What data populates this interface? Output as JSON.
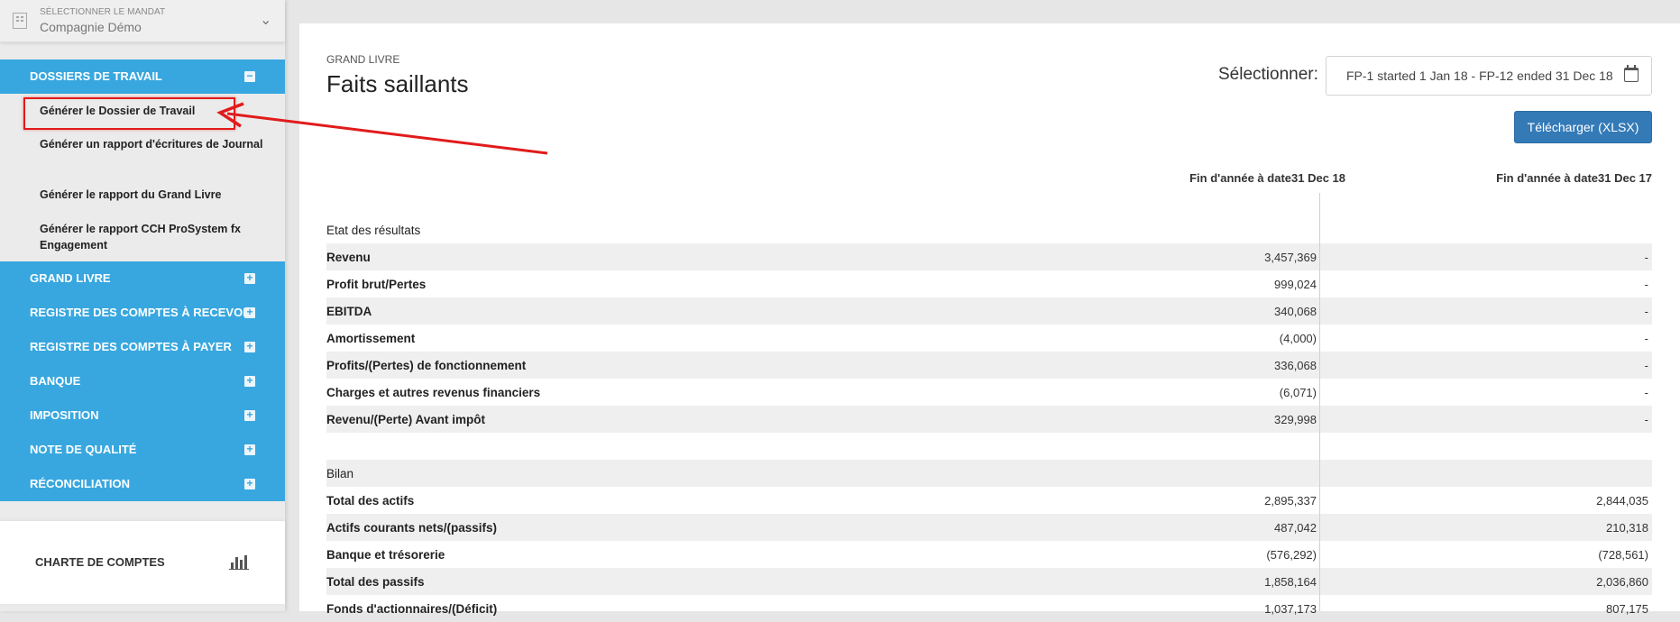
{
  "mandate": {
    "caption": "SÉLECTIONNER LE MANDAT",
    "name": "Compagnie Démo"
  },
  "sidebar": {
    "sections": [
      {
        "label": "DOSSIERS DE TRAVAIL",
        "toggle": "−"
      },
      {
        "label": "GRAND LIVRE",
        "toggle": "+"
      },
      {
        "label": "REGISTRE DES COMPTES À RECEVOIR",
        "toggle": "+"
      },
      {
        "label": "REGISTRE DES COMPTES À PAYER",
        "toggle": "+"
      },
      {
        "label": "BANQUE",
        "toggle": "+"
      },
      {
        "label": "IMPOSITION",
        "toggle": "+"
      },
      {
        "label": "NOTE DE QUALITÉ",
        "toggle": "+"
      },
      {
        "label": "RÉCONCILIATION",
        "toggle": "+"
      }
    ],
    "sub_items": [
      "Générer le Dossier de Travail",
      "Générer un rapport d'écritures de Journal",
      "Générer le rapport du Grand Livre",
      "Générer le rapport CCH ProSystem fx Engagement"
    ],
    "bottom_label": "CHARTE DE COMPTES"
  },
  "main": {
    "breadcrumb": "GRAND LIVRE",
    "title": "Faits saillants",
    "select_label": "Sélectionner:",
    "period": "FP-1 started 1 Jan 18 - FP-12 ended 31 Dec 18",
    "download_label": "Télécharger (XLSX)",
    "col1_header": "Fin d'année à date31 Dec 18",
    "col2_header": "Fin d'année à date31 Dec 17",
    "rows": [
      {
        "label": "Etat des résultats",
        "v1": "",
        "v2": "",
        "heading": true
      },
      {
        "label": "Revenu",
        "v1": "3,457,369",
        "v2": "-"
      },
      {
        "label": "Profit brut/Pertes",
        "v1": "999,024",
        "v2": "-"
      },
      {
        "label": "EBITDA",
        "v1": "340,068",
        "v2": "-"
      },
      {
        "label": "Amortissement",
        "v1": "(4,000)",
        "v2": "-"
      },
      {
        "label": "Profits/(Pertes) de fonctionnement",
        "v1": "336,068",
        "v2": "-"
      },
      {
        "label": "Charges et autres revenus financiers",
        "v1": "(6,071)",
        "v2": "-"
      },
      {
        "label": "Revenu/(Perte) Avant impôt",
        "v1": "329,998",
        "v2": "-"
      },
      {
        "label": "",
        "v1": "",
        "v2": "",
        "heading": true
      },
      {
        "label": "Bilan",
        "v1": "",
        "v2": "",
        "heading": true
      },
      {
        "label": "Total des actifs",
        "v1": "2,895,337",
        "v2": "2,844,035"
      },
      {
        "label": "Actifs courants nets/(passifs)",
        "v1": "487,042",
        "v2": "210,318"
      },
      {
        "label": "Banque et trésorerie",
        "v1": "(576,292)",
        "v2": "(728,561)"
      },
      {
        "label": "Total des passifs",
        "v1": "1,858,164",
        "v2": "2,036,860"
      },
      {
        "label": "Fonds d'actionnaires/(Déficit)",
        "v1": "1,037,173",
        "v2": "807,175"
      }
    ]
  },
  "colors": {
    "sidebar_accent": "#38a7df",
    "button": "#337ab7",
    "annotation": "#e11b1b"
  }
}
